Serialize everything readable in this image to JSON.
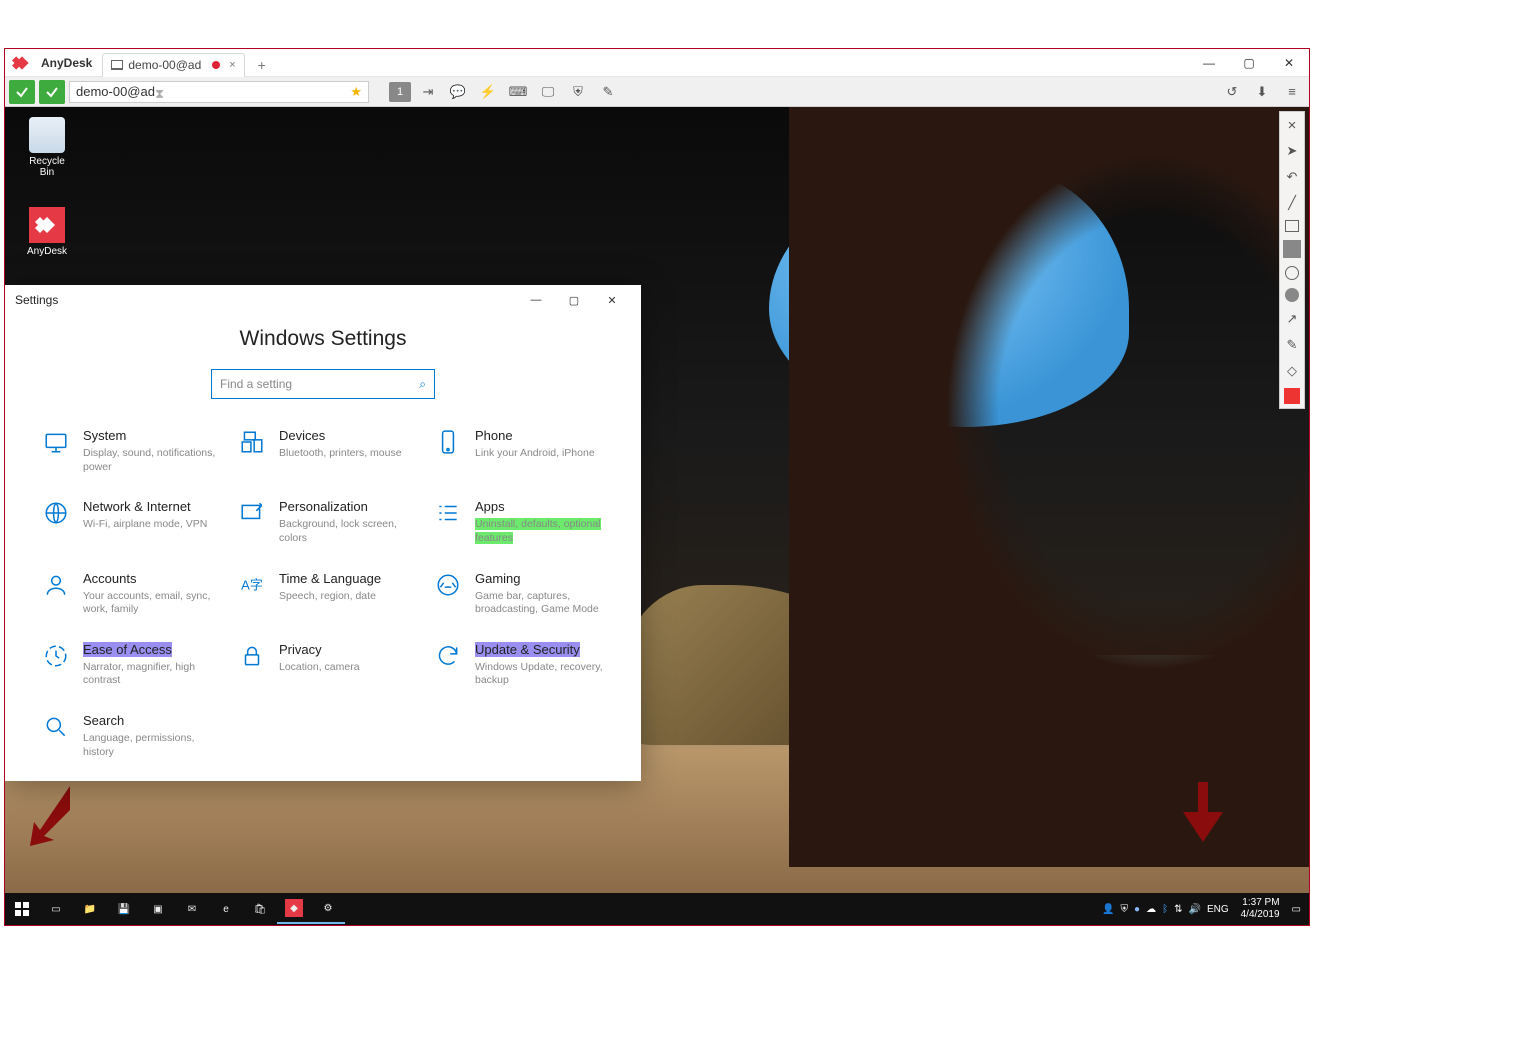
{
  "app": {
    "name": "AnyDesk",
    "tab_label": "demo-00@ad",
    "tab_plus": "+",
    "win_min": "—",
    "win_max": "▢",
    "win_close": "✕"
  },
  "toolbar": {
    "address": "demo-00@ad",
    "monitor_badge": "1"
  },
  "desktop": {
    "icons": [
      {
        "label": "Recycle Bin"
      },
      {
        "label": "AnyDesk"
      }
    ]
  },
  "settings": {
    "window_title": "Settings",
    "heading": "Windows Settings",
    "search_placeholder": "Find a setting",
    "items": [
      {
        "title": "System",
        "desc": "Display, sound, notifications, power"
      },
      {
        "title": "Devices",
        "desc": "Bluetooth, printers, mouse"
      },
      {
        "title": "Phone",
        "desc": "Link your Android, iPhone"
      },
      {
        "title": "Network & Internet",
        "desc": "Wi-Fi, airplane mode, VPN"
      },
      {
        "title": "Personalization",
        "desc": "Background, lock screen, colors"
      },
      {
        "title": "Apps",
        "desc": "Uninstall, defaults, optional features"
      },
      {
        "title": "Accounts",
        "desc": "Your accounts, email, sync, work, family"
      },
      {
        "title": "Time & Language",
        "desc": "Speech, region, date"
      },
      {
        "title": "Gaming",
        "desc": "Game bar, captures, broadcasting, Game Mode"
      },
      {
        "title": "Ease of Access",
        "desc": "Narrator, magnifier, high contrast"
      },
      {
        "title": "Privacy",
        "desc": "Location, camera"
      },
      {
        "title": "Update & Security",
        "desc": "Windows Update, recovery, backup"
      },
      {
        "title": "Search",
        "desc": "Language, permissions, history"
      }
    ]
  },
  "taskbar": {
    "lang": "ENG",
    "time": "1:37 PM",
    "date": "4/4/2019"
  }
}
